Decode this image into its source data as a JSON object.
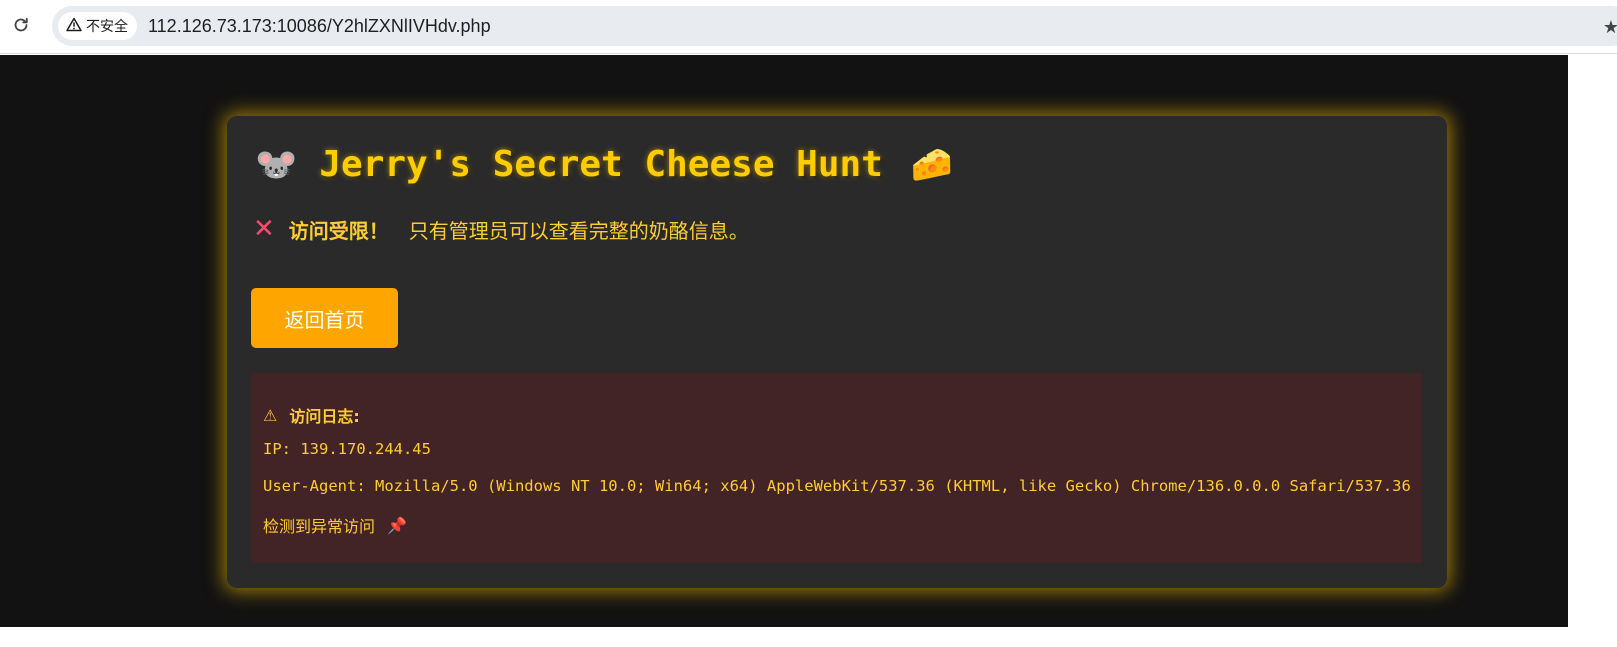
{
  "browser": {
    "security_label": "不安全",
    "url": "112.126.73.173:10086/Y2hlZXNlIVHdv.php",
    "icons": {
      "reload": "reload-icon",
      "warning": "warning-icon",
      "bookmark": "star-icon"
    }
  },
  "page": {
    "title": "Jerry's Secret Cheese Hunt",
    "title_emoji_left": "🐭",
    "title_emoji_right": "🧀",
    "denied_icon": "❌",
    "denied_strong": "访问受限！",
    "denied_message": "只有管理员可以查看完整的奶酪信息。",
    "home_button": "返回首页",
    "log": {
      "icon": "⚠",
      "title": "访问日志:",
      "ip_line": "IP: 139.170.244.45",
      "ua_line": "User-Agent: Mozilla/5.0 (Windows NT 10.0; Win64; x64) AppleWebKit/537.36 (KHTML, like Gecko) Chrome/136.0.0.0 Safari/537.36",
      "note": "检测到异常访问",
      "note_icon": "📌"
    }
  },
  "colors": {
    "page_bg": "#121212",
    "card_bg": "#2a2a2a",
    "accent": "#ffcc00",
    "button": "#ffa500",
    "log_bg": "#432426",
    "error": "#ff4a6e"
  }
}
